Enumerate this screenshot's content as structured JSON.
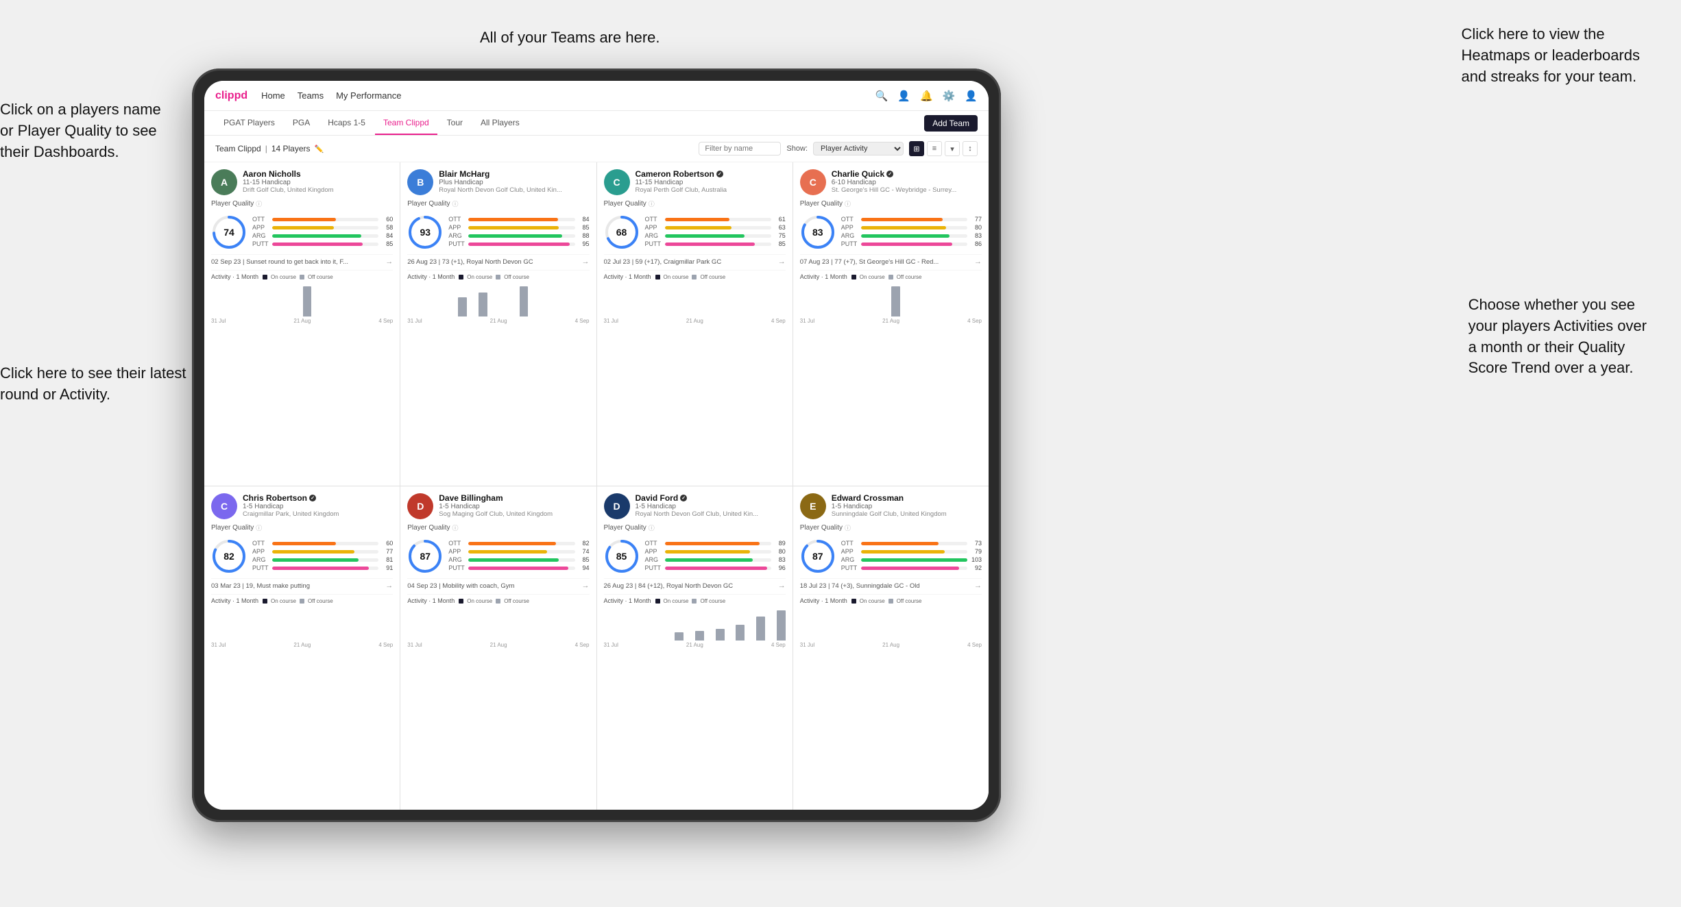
{
  "annotations": {
    "teams_tooltip": "All of your Teams are here.",
    "heatmaps_tooltip": "Click here to view the\nHeatmaps or leaderboards\nand streaks for your team.",
    "player_name_tooltip": "Click on a players name\nor Player Quality to see\ntheir Dashboards.",
    "latest_round_tooltip": "Click here to see their latest\nround or Activity.",
    "activities_tooltip": "Choose whether you see\nyour players Activities over\na month or their Quality\nScore Trend over a year."
  },
  "navbar": {
    "brand": "clippd",
    "links": [
      "Home",
      "Teams",
      "My Performance"
    ],
    "active_link": "My Performance"
  },
  "subnav": {
    "tabs": [
      "PGAT Players",
      "PGA",
      "Hcaps 1-5",
      "Team Clippd",
      "Tour",
      "All Players"
    ],
    "active_tab": "Team Clippd",
    "add_team_label": "Add Team"
  },
  "team_header": {
    "title": "Team Clippd",
    "player_count": "14 Players",
    "filter_placeholder": "Filter by name",
    "show_label": "Show:",
    "show_value": "Player Activity",
    "view_options": [
      "grid-2",
      "grid-3",
      "filter",
      "sort"
    ]
  },
  "players": [
    {
      "name": "Aaron Nicholls",
      "handicap": "11-15 Handicap",
      "club": "Drift Golf Club, United Kingdom",
      "quality": 74,
      "quality_color": "#3b82f6",
      "bars": [
        {
          "label": "OTT",
          "color": "#f97316",
          "value": 60
        },
        {
          "label": "APP",
          "color": "#eab308",
          "value": 58
        },
        {
          "label": "ARG",
          "color": "#22c55e",
          "value": 84
        },
        {
          "label": "PUTT",
          "color": "#ec4899",
          "value": 85
        }
      ],
      "latest_round": "02 Sep 23 | Sunset round to get back into it, F...",
      "has_chart": true,
      "chart_bars": [
        0,
        0,
        0,
        0,
        0,
        0,
        0,
        0,
        0,
        12,
        0,
        0,
        0,
        0,
        0,
        0,
        0,
        0
      ],
      "chart_labels": [
        "31 Jul",
        "21 Aug",
        "4 Sep"
      ],
      "av_color": "av-green",
      "av_letter": "A",
      "verified": false
    },
    {
      "name": "Blair McHarg",
      "handicap": "Plus Handicap",
      "club": "Royal North Devon Golf Club, United Kin...",
      "quality": 93,
      "quality_color": "#3b82f6",
      "bars": [
        {
          "label": "OTT",
          "color": "#f97316",
          "value": 84
        },
        {
          "label": "APP",
          "color": "#eab308",
          "value": 85
        },
        {
          "label": "ARG",
          "color": "#22c55e",
          "value": 88
        },
        {
          "label": "PUTT",
          "color": "#ec4899",
          "value": 95
        }
      ],
      "latest_round": "26 Aug 23 | 73 (+1), Royal North Devon GC",
      "has_chart": true,
      "chart_bars": [
        0,
        0,
        0,
        0,
        0,
        18,
        0,
        22,
        0,
        0,
        0,
        28,
        0,
        0,
        0,
        0,
        0,
        0
      ],
      "chart_labels": [
        "31 Jul",
        "21 Aug",
        "4 Sep"
      ],
      "av_color": "av-blue",
      "av_letter": "B",
      "verified": false
    },
    {
      "name": "Cameron Robertson",
      "handicap": "11-15 Handicap",
      "club": "Royal Perth Golf Club, Australia",
      "quality": 68,
      "quality_color": "#3b82f6",
      "bars": [
        {
          "label": "OTT",
          "color": "#f97316",
          "value": 61
        },
        {
          "label": "APP",
          "color": "#eab308",
          "value": 63
        },
        {
          "label": "ARG",
          "color": "#22c55e",
          "value": 75
        },
        {
          "label": "PUTT",
          "color": "#ec4899",
          "value": 85
        }
      ],
      "latest_round": "02 Jul 23 | 59 (+17), Craigmillar Park GC",
      "has_chart": true,
      "chart_bars": [
        0,
        0,
        0,
        0,
        0,
        0,
        0,
        0,
        0,
        0,
        0,
        0,
        0,
        0,
        0,
        0,
        0,
        0
      ],
      "chart_labels": [
        "31 Jul",
        "21 Aug",
        "4 Sep"
      ],
      "av_color": "av-teal",
      "av_letter": "C",
      "verified": true
    },
    {
      "name": "Charlie Quick",
      "handicap": "6-10 Handicap",
      "club": "St. George's Hill GC - Weybridge - Surrey...",
      "quality": 83,
      "quality_color": "#3b82f6",
      "bars": [
        {
          "label": "OTT",
          "color": "#f97316",
          "value": 77
        },
        {
          "label": "APP",
          "color": "#eab308",
          "value": 80
        },
        {
          "label": "ARG",
          "color": "#22c55e",
          "value": 83
        },
        {
          "label": "PUTT",
          "color": "#ec4899",
          "value": 86
        }
      ],
      "latest_round": "07 Aug 23 | 77 (+7), St George's Hill GC - Red...",
      "has_chart": true,
      "chart_bars": [
        0,
        0,
        0,
        0,
        0,
        0,
        0,
        0,
        0,
        8,
        0,
        0,
        0,
        0,
        0,
        0,
        0,
        0
      ],
      "chart_labels": [
        "31 Jul",
        "21 Aug",
        "4 Sep"
      ],
      "av_color": "av-orange",
      "av_letter": "C",
      "verified": true
    },
    {
      "name": "Chris Robertson",
      "handicap": "1-5 Handicap",
      "club": "Craigmillar Park, United Kingdom",
      "quality": 82,
      "quality_color": "#3b82f6",
      "bars": [
        {
          "label": "OTT",
          "color": "#f97316",
          "value": 60
        },
        {
          "label": "APP",
          "color": "#eab308",
          "value": 77
        },
        {
          "label": "ARG",
          "color": "#22c55e",
          "value": 81
        },
        {
          "label": "PUTT",
          "color": "#ec4899",
          "value": 91
        }
      ],
      "latest_round": "03 Mar 23 | 19, Must make putting",
      "has_chart": true,
      "chart_bars": [
        0,
        0,
        0,
        0,
        0,
        0,
        0,
        0,
        0,
        0,
        0,
        0,
        0,
        0,
        0,
        0,
        0,
        0
      ],
      "chart_labels": [
        "31 Jul",
        "21 Aug",
        "4 Sep"
      ],
      "av_color": "av-purple",
      "av_letter": "C",
      "verified": true
    },
    {
      "name": "Dave Billingham",
      "handicap": "1-5 Handicap",
      "club": "Sog Maging Golf Club, United Kingdom",
      "quality": 87,
      "quality_color": "#3b82f6",
      "bars": [
        {
          "label": "OTT",
          "color": "#f97316",
          "value": 82
        },
        {
          "label": "APP",
          "color": "#eab308",
          "value": 74
        },
        {
          "label": "ARG",
          "color": "#22c55e",
          "value": 85
        },
        {
          "label": "PUTT",
          "color": "#ec4899",
          "value": 94
        }
      ],
      "latest_round": "04 Sep 23 | Mobility with coach, Gym",
      "has_chart": true,
      "chart_bars": [
        0,
        0,
        0,
        0,
        0,
        0,
        0,
        0,
        0,
        0,
        0,
        0,
        0,
        0,
        0,
        0,
        0,
        0
      ],
      "chart_labels": [
        "31 Jul",
        "21 Aug",
        "4 Sep"
      ],
      "av_color": "av-red",
      "av_letter": "D",
      "verified": false
    },
    {
      "name": "David Ford",
      "handicap": "1-5 Handicap",
      "club": "Royal North Devon Golf Club, United Kin...",
      "quality": 85,
      "quality_color": "#3b82f6",
      "bars": [
        {
          "label": "OTT",
          "color": "#f97316",
          "value": 89
        },
        {
          "label": "APP",
          "color": "#eab308",
          "value": 80
        },
        {
          "label": "ARG",
          "color": "#22c55e",
          "value": 83
        },
        {
          "label": "PUTT",
          "color": "#ec4899",
          "value": 96
        }
      ],
      "latest_round": "26 Aug 23 | 84 (+12), Royal North Devon GC",
      "has_chart": true,
      "chart_bars": [
        0,
        0,
        0,
        0,
        0,
        0,
        0,
        10,
        0,
        12,
        0,
        15,
        0,
        20,
        0,
        30,
        0,
        38
      ],
      "chart_labels": [
        "31 Jul",
        "21 Aug",
        "4 Sep"
      ],
      "av_color": "av-darkblue",
      "av_letter": "D",
      "verified": true
    },
    {
      "name": "Edward Crossman",
      "handicap": "1-5 Handicap",
      "club": "Sunningdale Golf Club, United Kingdom",
      "quality": 87,
      "quality_color": "#3b82f6",
      "bars": [
        {
          "label": "OTT",
          "color": "#f97316",
          "value": 73
        },
        {
          "label": "APP",
          "color": "#eab308",
          "value": 79
        },
        {
          "label": "ARG",
          "color": "#22c55e",
          "value": 103
        },
        {
          "label": "PUTT",
          "color": "#ec4899",
          "value": 92
        }
      ],
      "latest_round": "18 Jul 23 | 74 (+3), Sunningdale GC - Old",
      "has_chart": true,
      "chart_bars": [
        0,
        0,
        0,
        0,
        0,
        0,
        0,
        0,
        0,
        0,
        0,
        0,
        0,
        0,
        0,
        0,
        0,
        0
      ],
      "chart_labels": [
        "31 Jul",
        "21 Aug",
        "4 Sep"
      ],
      "av_color": "av-brown",
      "av_letter": "E",
      "verified": false
    }
  ],
  "activity": {
    "title": "Activity",
    "period": "1 Month",
    "on_course_label": "On course",
    "off_course_label": "Off course",
    "on_course_color": "#1a1a2e",
    "off_course_color": "#9ca3af"
  }
}
